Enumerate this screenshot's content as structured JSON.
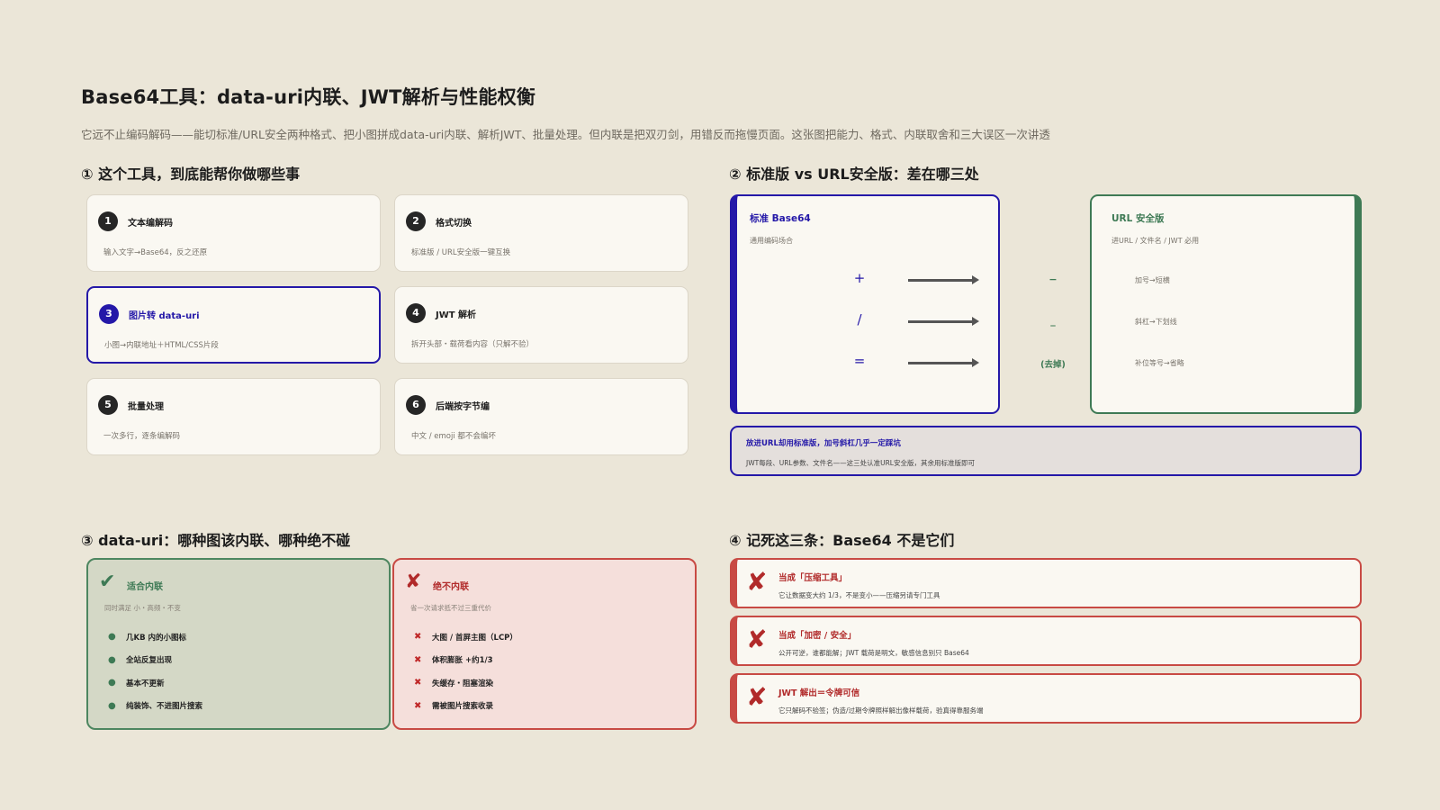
{
  "header": {
    "title": "Base64工具：data-uri内联、JWT解析与性能权衡",
    "subtitle": "它远不止编码解码——能切标准/URL安全两种格式、把小图拼成data-uri内联、解析JWT、批量处理。但内联是把双刃剑，用错反而拖慢页面。这张图把能力、格式、内联取舍和三大误区一次讲透"
  },
  "section1": {
    "title": "① 这个工具，到底能帮你做哪些事",
    "cards": [
      {
        "num": "1",
        "title": "文本编解码",
        "desc": "输入文字→Base64，反之还原"
      },
      {
        "num": "2",
        "title": "格式切换",
        "desc": "标准版 / URL安全版一键互换"
      },
      {
        "num": "3",
        "title": "图片转 data-uri",
        "desc": "小图→内联地址＋HTML/CSS片段"
      },
      {
        "num": "4",
        "title": "JWT 解析",
        "desc": "拆开头部・载荷看内容（只解不验）"
      },
      {
        "num": "5",
        "title": "批量处理",
        "desc": "一次多行，逐条编解码"
      },
      {
        "num": "6",
        "title": "后端按字节编",
        "desc": "中文 / emoji 都不会编坏"
      }
    ]
  },
  "section2": {
    "title": "② 标准版 vs URL安全版：差在哪三处",
    "standard": {
      "title": "标准 Base64",
      "subtitle": "通用编码场合",
      "symbols": [
        "+",
        "/",
        "="
      ]
    },
    "url_safe": {
      "title": "URL 安全版",
      "subtitle": "进URL / 文件名 / JWT 必用",
      "labels": [
        "加号→短横",
        "斜杠→下划线",
        "补位等号→省略"
      ]
    },
    "replacements": [
      "−",
      "_",
      "(去掉)"
    ],
    "note": {
      "title": "放进URL却用标准版，加号斜杠几乎一定踩坑",
      "desc": "JWT每段、URL参数、文件名——这三处认准URL安全版，其余用标准版即可"
    }
  },
  "section3": {
    "title": "③ data-uri：哪种图该内联、哪种绝不碰",
    "good": {
      "icon": "✔",
      "title": "适合内联",
      "subtitle": "同时满足 小・高频・不变",
      "items": [
        "几KB 内的小图标",
        "全站反复出现",
        "基本不更新",
        "纯装饰、不进图片搜索"
      ]
    },
    "bad": {
      "icon": "✘",
      "title": "绝不内联",
      "subtitle": "省一次请求抵不过三重代价",
      "items": [
        "大图 / 首屏主图（LCP）",
        "体积膨胀 +约1/3",
        "失缓存・阻塞渲染",
        "需被图片搜索收录"
      ]
    }
  },
  "section4": {
    "title": "④ 记死这三条：Base64 不是它们",
    "myths": [
      {
        "title": "当成「压缩工具」",
        "desc": "它让数据变大约 1/3，不是变小——压缩另请专门工具"
      },
      {
        "title": "当成「加密 / 安全」",
        "desc": "公开可逆，谁都能解；JWT 载荷是明文，敏感信息别只 Base64"
      },
      {
        "title": "JWT 解出＝令牌可信",
        "desc": "它只解码不验签；伪造/过期令牌照样解出像样载荷，验真得靠服务端"
      }
    ]
  },
  "colors": {
    "accent": "#2418a8",
    "good": "#3e7a55",
    "bad": "#b12a2a",
    "background": "#ebe6d8"
  }
}
